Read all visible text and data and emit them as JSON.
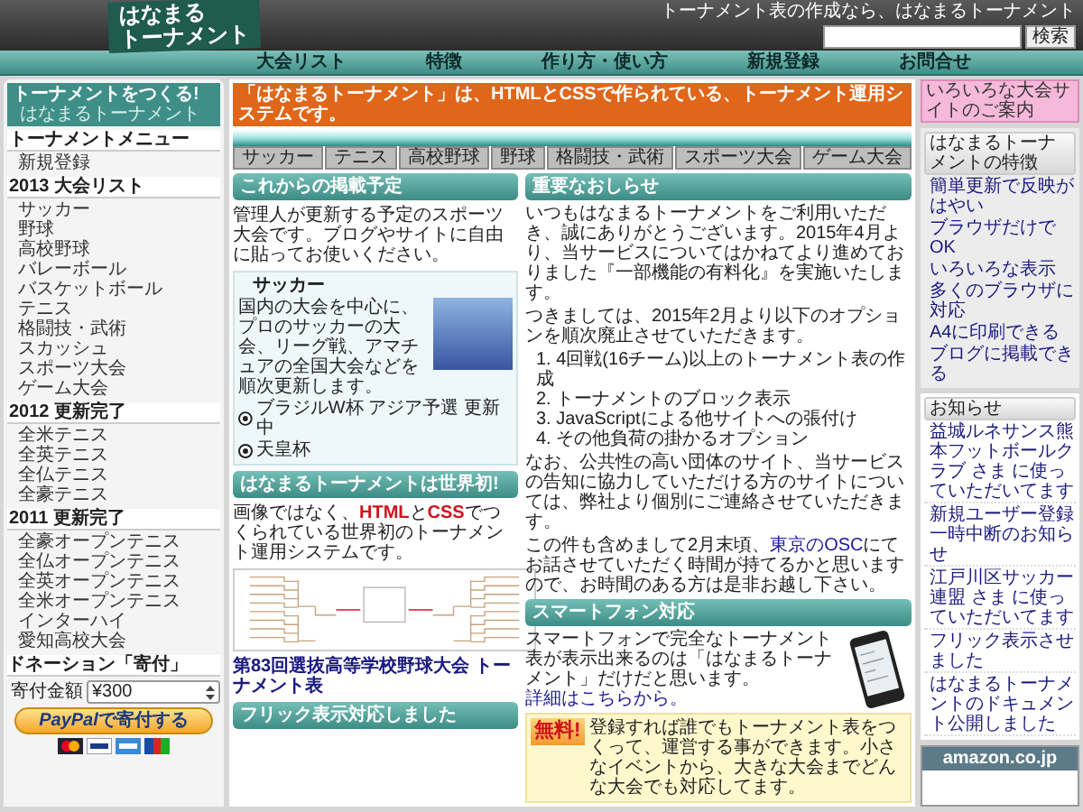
{
  "header": {
    "logo": [
      "はなまる",
      "トーナメント"
    ],
    "tagline": "トーナメント表の作成なら、はなまるトーナメント",
    "search_button": "検索"
  },
  "nav": [
    "大会リスト",
    "特徴",
    "作り方・使い方",
    "新規登録",
    "お問合せ"
  ],
  "left_sidebar": {
    "banner": {
      "title": "トーナメントをつくる!",
      "subtitle": "はなまるトーナメント"
    },
    "sections": [
      {
        "title": "トーナメントメニュー",
        "items": [
          "新規登録"
        ]
      },
      {
        "title": "2013 大会リスト",
        "items": [
          "サッカー",
          "野球",
          "高校野球",
          "バレーボール",
          "バスケットボール",
          "テニス",
          "格闘技・武術",
          "スカッシュ",
          "スポーツ大会",
          "ゲーム大会"
        ]
      },
      {
        "title": "2012 更新完了",
        "items": [
          "全米テニス",
          "全英テニス",
          "全仏テニス",
          "全豪テニス"
        ]
      },
      {
        "title": "2011 更新完了",
        "items": [
          "全豪オープンテニス",
          "全仏オープンテニス",
          "全英オープンテニス",
          "全米オープンテニス",
          "インターハイ",
          "愛知高校大会"
        ]
      }
    ],
    "donation": {
      "title": "ドネーション「寄付」",
      "amount_label": "寄付金額",
      "amount": "¥300",
      "button": {
        "brand": "PayPal",
        "text": "で寄付する"
      }
    }
  },
  "intro_banner": "「はなまるトーナメント」は、HTMLとCSSで作られている、トーナメント運用システムです。",
  "sport_tabs": [
    "サッカー",
    "テニス",
    "高校野球",
    "野球",
    "格闘技・武術",
    "スポーツ大会",
    "ゲーム大会"
  ],
  "schedule": {
    "title": "これからの掲載予定",
    "text": "管理人が更新する予定のスポーツ大会です。ブログやサイトに自由に貼ってお使いください。",
    "card": {
      "title": "サッカー",
      "text": "国内の大会を中心に、プロのサッカーの大会、リーグ戦、アマチュアの全国大会などを順次更新します。",
      "links": [
        "ブラジルW杯 アジア予選 更新中",
        "天皇杯"
      ]
    }
  },
  "world_first": {
    "title": "はなまるトーナメントは世界初!",
    "segments": [
      {
        "text": "画像ではなく、",
        "highlight": false
      },
      {
        "text": "HTML",
        "highlight": true
      },
      {
        "text": "と",
        "highlight": false
      },
      {
        "text": "CSS",
        "highlight": true
      },
      {
        "text": "でつくられている世界初のトーナメント運用システムです。",
        "highlight": false
      }
    ],
    "caption": "第83回選抜高等学校野球大会 トーナメント表"
  },
  "flick": {
    "title": "フリック表示対応しました"
  },
  "notice": {
    "title": "重要なおしらせ",
    "blocks": [
      {
        "kind": "paragraph",
        "segments": [
          {
            "text": "いつもはなまるトーナメントをご利用いただき、誠にありがとうございます。2015年4月より、当サービスについてはかねてより進めておりました『一部機能の有料化』を実施いたします。",
            "link": false
          }
        ]
      },
      {
        "kind": "paragraph",
        "segments": [
          {
            "text": "つきましては、2015年2月より以下のオプションを順次廃止させていただきます。",
            "link": false
          }
        ]
      },
      {
        "kind": "list",
        "items": [
          "1. 4回戦(16チーム)以上のトーナメント表の作成",
          "2. トーナメントのブロック表示",
          "3. JavaScriptによる他サイトへの張付け",
          "4. その他負荷の掛かるオプション"
        ]
      },
      {
        "kind": "paragraph",
        "segments": [
          {
            "text": "なお、公共性の高い団体のサイト、当サービスの告知に協力していただける方のサイトについては、弊社より個別にご連絡させていただきます。",
            "link": false
          }
        ]
      },
      {
        "kind": "paragraph",
        "segments": [
          {
            "text": "この件も含めまして2月末頃、",
            "link": false
          },
          {
            "text": "東京のOSC",
            "link": true
          },
          {
            "text": "にてお話させていただく時間が持てるかと思いますので、お時間のある方は是非お越し下さい。",
            "link": false
          }
        ]
      }
    ]
  },
  "smartphone": {
    "title": "スマートフォン対応",
    "text": "スマートフォンで完全なトーナメント表が表示出来るのは「はなまるトーナメント」だけだと思います。",
    "link": "詳細はこちらから。"
  },
  "free": {
    "badge": "無料!",
    "text": "登録すれば誰でもトーナメント表をつくって、運営する事ができます。小さなイベントから、大きな大会までどんな大会でも対応してます。"
  },
  "right_sidebar": {
    "sites_button": "いろいろな大会サイトのご案内",
    "features": {
      "title": "はなまるトーナメントの特徴",
      "items": [
        "簡単更新で反映がはやい",
        "ブラウザだけでOK",
        "いろいろな表示",
        "多くのブラウザに対応",
        "A4に印刷できる",
        "ブログに掲載できる"
      ]
    },
    "news": {
      "title": "お知らせ",
      "items": [
        "益城ルネサンス熊本フットボールクラブ さま に使っていただいてます",
        "新規ユーザー登録一時中断のお知らせ",
        "江戸川区サッカー連盟 さま に使っていただいてます",
        "フリック表示させました",
        "はなまるトーナメントのドキュメント公開しました"
      ]
    },
    "amazon": {
      "logo": "amazon.co.jp"
    }
  }
}
